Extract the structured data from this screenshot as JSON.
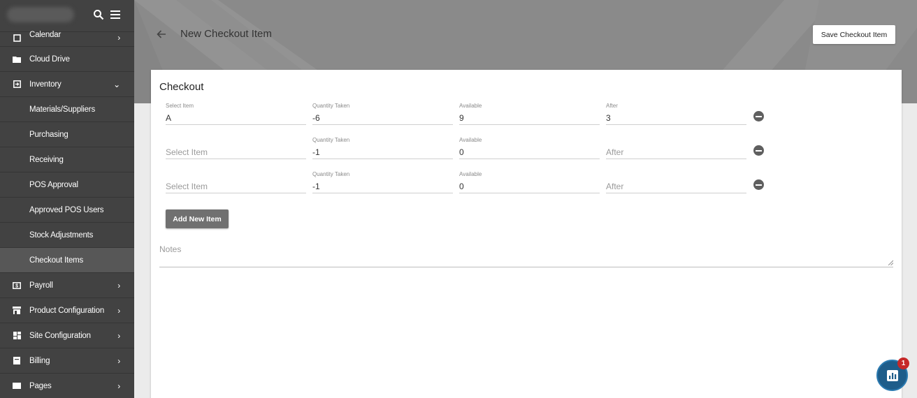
{
  "sidebar": {
    "items": [
      {
        "label": "Calendar",
        "icon": "calendar-icon",
        "chevron": "›"
      },
      {
        "label": "Cloud Drive",
        "icon": "folder-icon",
        "chevron": ""
      },
      {
        "label": "Inventory",
        "icon": "inventory-icon",
        "chevron": "⌄"
      },
      {
        "label": "Materials/Suppliers"
      },
      {
        "label": "Purchasing"
      },
      {
        "label": "Receiving"
      },
      {
        "label": "POS Approval"
      },
      {
        "label": "Approved POS Users"
      },
      {
        "label": "Stock Adjustments"
      },
      {
        "label": "Checkout Items"
      },
      {
        "label": "Payroll",
        "icon": "payroll-icon",
        "chevron": "›"
      },
      {
        "label": "Product Configuration",
        "icon": "store-icon",
        "chevron": "›"
      },
      {
        "label": "Site Configuration",
        "icon": "dashboard-icon",
        "chevron": "›"
      },
      {
        "label": "Billing",
        "icon": "billing-icon",
        "chevron": "›"
      },
      {
        "label": "Pages",
        "icon": "pages-icon",
        "chevron": "›"
      }
    ]
  },
  "header": {
    "title": "New Checkout Item",
    "save_label": "Save Checkout Item"
  },
  "checkout": {
    "title": "Checkout",
    "rows": [
      {
        "item": {
          "label": "Select Item",
          "value": "A",
          "placeholder": ""
        },
        "qty": {
          "label": "Quantity Taken",
          "value": "-6"
        },
        "available": {
          "label": "Available",
          "value": "9"
        },
        "after": {
          "label": "After",
          "value": "3",
          "placeholder": ""
        }
      },
      {
        "item": {
          "label": "",
          "value": "",
          "placeholder": "Select Item"
        },
        "qty": {
          "label": "Quantity Taken",
          "value": "-1"
        },
        "available": {
          "label": "Available",
          "value": "0"
        },
        "after": {
          "label": "",
          "value": "",
          "placeholder": "After"
        }
      },
      {
        "item": {
          "label": "",
          "value": "",
          "placeholder": "Select Item"
        },
        "qty": {
          "label": "Quantity Taken",
          "value": "-1"
        },
        "available": {
          "label": "Available",
          "value": "0"
        },
        "after": {
          "label": "",
          "value": "",
          "placeholder": "After"
        }
      }
    ],
    "add_label": "Add New Item",
    "notes_placeholder": "Notes"
  },
  "widget": {
    "badge": "1"
  },
  "colors": {
    "sidebar_bg": "#424242",
    "header_bg": "#8a8a8a",
    "badge": "#c62828",
    "fab": "#1e5d8a"
  }
}
